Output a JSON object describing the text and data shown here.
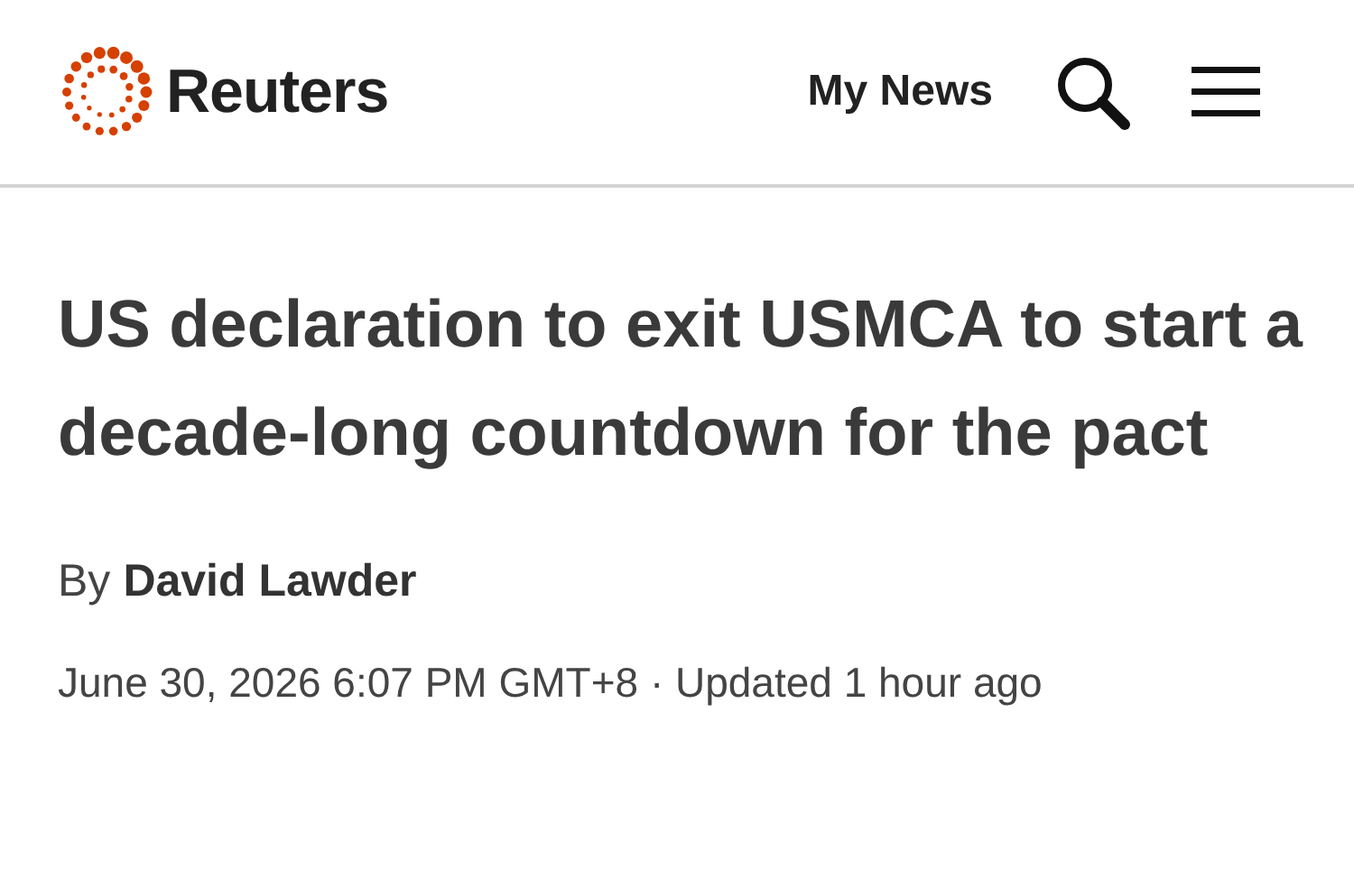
{
  "header": {
    "brand": "Reuters",
    "nav_link": "My News"
  },
  "article": {
    "headline": "US declaration to exit USMCA to start a decade-long countdown for the pact",
    "byline_prefix": "By",
    "author": "David Lawder",
    "dateline": "June 30, 2026 6:07 PM GMT+8 · Updated 1 hour ago"
  }
}
